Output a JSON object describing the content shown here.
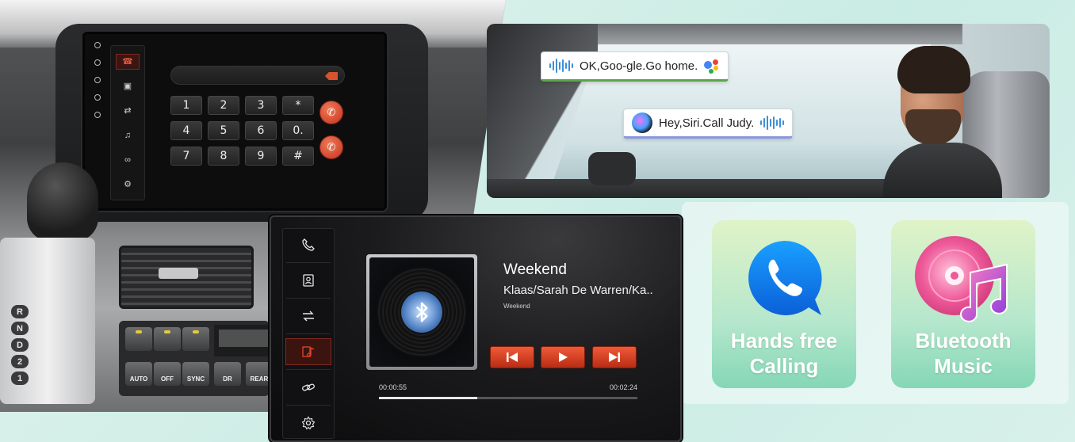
{
  "head_unit": {
    "keypad": [
      "1",
      "2",
      "3",
      "*",
      "4",
      "5",
      "6",
      "0.",
      "7",
      "8",
      "9",
      "#"
    ],
    "sidebar": [
      "phone",
      "contacts",
      "transfer",
      "music",
      "link",
      "settings"
    ]
  },
  "gear": {
    "positions": [
      "R",
      "N",
      "D",
      "2",
      "1"
    ]
  },
  "climate": {
    "buttons": [
      "AUTO",
      "OFF",
      "SYNC"
    ],
    "radio_labels": [
      "DR",
      "REAR"
    ]
  },
  "voice": {
    "google_command": "OK,Goo-gle.Go home.",
    "siri_command": "Hey,Siri.Call Judy."
  },
  "player": {
    "song_title": "Weekend",
    "artist": "Klaas/Sarah De Warren/Ka..",
    "album": "Weekend",
    "elapsed": "00:00:55",
    "duration": "00:02:24",
    "progress": 0.38,
    "sidebar_items": [
      "phone-icon",
      "contacts-icon",
      "transfer-icon",
      "music-icon",
      "link-icon",
      "settings-icon"
    ],
    "active_item": "music-icon",
    "accent": "#e2472a"
  },
  "features": {
    "calling": {
      "line1": "Hands free",
      "line2": "Calling"
    },
    "music": {
      "line1": "Bluetooth",
      "line2": "Music"
    }
  }
}
